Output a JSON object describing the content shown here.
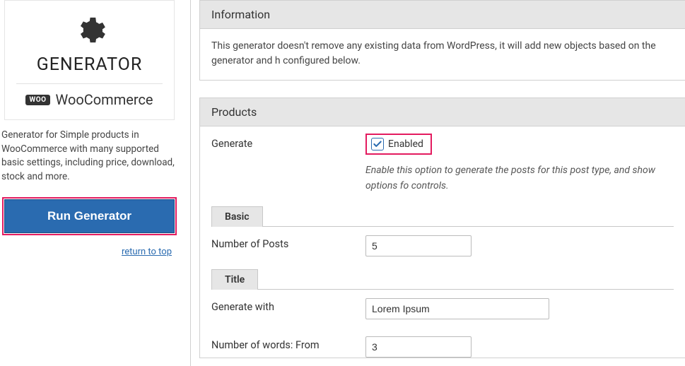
{
  "sidebar": {
    "title": "GENERATOR",
    "woo_badge": "WOO",
    "woo_text": "WooCommerce",
    "description": "Generator for Simple products in WooCommerce with many supported basic settings, including price, download, stock and more.",
    "run_button": "Run Generator",
    "return_link": "return to top"
  },
  "sections": {
    "information": {
      "header": "Information",
      "body": "This generator doesn't remove any existing data from WordPress, it will add new objects based on the generator and h configured below."
    },
    "products": {
      "header": "Products",
      "generate": {
        "label": "Generate",
        "checkbox_label": "Enabled",
        "checked": true,
        "help": "Enable this option to generate the posts for this post type, and show options fo controls."
      },
      "tab_basic": "Basic",
      "num_posts": {
        "label": "Number of Posts",
        "value": "5"
      },
      "tab_title": "Title",
      "generate_with": {
        "label": "Generate with",
        "value": "Lorem Ipsum"
      },
      "words_from": {
        "label": "Number of words: From",
        "value": "3"
      }
    }
  }
}
